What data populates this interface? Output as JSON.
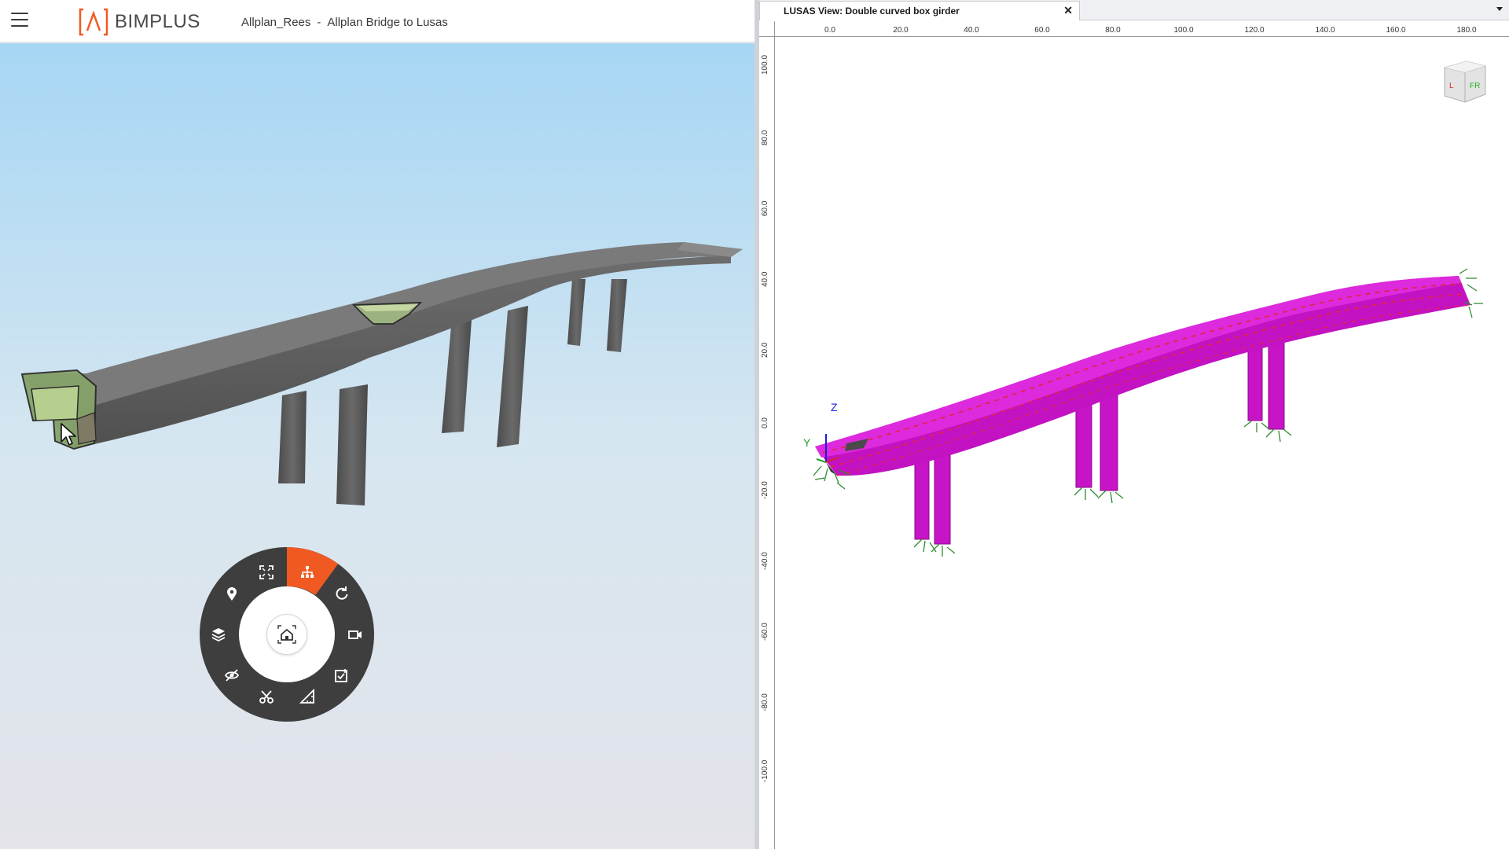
{
  "bimplus": {
    "brand": "BIMPLUS",
    "project": "Allplan_Rees",
    "separator": "-",
    "model": "Allplan Bridge to Lusas",
    "colors": {
      "accent": "#f05a22",
      "sky_top": "#a9d8f5",
      "sky_bottom": "#e6e7ec",
      "deck": "#727272",
      "menu_ring": "#3e3e3e"
    },
    "radial_menu": {
      "center": {
        "name": "home-icon"
      },
      "items": [
        {
          "name": "structure-icon",
          "active": true
        },
        {
          "name": "rotate-icon",
          "active": false
        },
        {
          "name": "camera-icon",
          "active": false
        },
        {
          "name": "checklist-icon",
          "active": false
        },
        {
          "name": "measure-icon",
          "active": false
        },
        {
          "name": "clip-icon",
          "active": false
        },
        {
          "name": "hide-icon",
          "active": false
        },
        {
          "name": "layers-icon",
          "active": false
        },
        {
          "name": "location-pin-icon",
          "active": false
        },
        {
          "name": "fullscreen-icon",
          "active": false
        }
      ]
    },
    "icons": {
      "menu": "hamburger-icon",
      "logo": "bimplus-logo-icon",
      "cursor": "mouse-cursor-icon"
    }
  },
  "lusas": {
    "tab_title": "LUSAS View: Double curved box girder",
    "close_label": "✕",
    "x_ticks": [
      "0.0",
      "20.0",
      "40.0",
      "60.0",
      "80.0",
      "100.0",
      "120.0",
      "140.0",
      "160.0",
      "180.0"
    ],
    "y_ticks": [
      "100.0",
      "80.0",
      "60.0",
      "40.0",
      "20.0",
      "0.0",
      "-20.0",
      "-40.0",
      "-60.0",
      "-80.0",
      "-100.0"
    ],
    "axis_labels": {
      "z": "Z",
      "y": "Y"
    },
    "view_cube_labels": {
      "front": "FR",
      "left": "L"
    },
    "colors": {
      "model": "#d21ad2",
      "mesh_line": "#e0254a",
      "supports": "#2e8b2e"
    }
  }
}
